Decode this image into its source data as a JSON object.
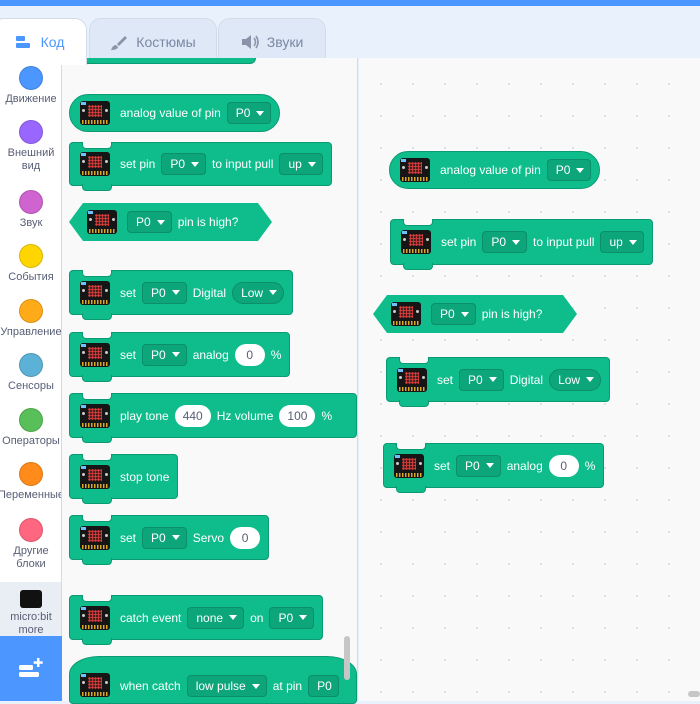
{
  "tabs": {
    "code": "Код",
    "costumes": "Костюмы",
    "sounds": "Звуки"
  },
  "categories": [
    {
      "label": "Движение",
      "color": "#4c97ff"
    },
    {
      "label": "Внешний вид",
      "color": "#9966ff"
    },
    {
      "label": "Звук",
      "color": "#cf63cf"
    },
    {
      "label": "События",
      "color": "#ffd500"
    },
    {
      "label": "Управление",
      "color": "#ffab19"
    },
    {
      "label": "Сенсоры",
      "color": "#5cb1d6"
    },
    {
      "label": "Операторы",
      "color": "#59c059"
    },
    {
      "label": "Переменные",
      "color": "#ff8c1a"
    },
    {
      "label": "Другие блоки",
      "color": "#ff6680"
    },
    {
      "label": "micro:bit more",
      "color": "#0fbd8c"
    }
  ],
  "blocks": {
    "analog_value": {
      "text": "analog value of pin",
      "pin": "P0"
    },
    "set_pull": {
      "set": "set pin",
      "pin": "P0",
      "mid": "to input pull",
      "pull": "up"
    },
    "pin_high": {
      "pin": "P0",
      "text": "pin is high?"
    },
    "set_digital": {
      "set": "set",
      "pin": "P0",
      "mid": "Digital",
      "value": "Low"
    },
    "set_analog": {
      "set": "set",
      "pin": "P0",
      "mid": "analog",
      "value": "0",
      "unit": "%"
    },
    "play_tone": {
      "text": "play tone",
      "freq": "440",
      "mid": "Hz volume",
      "volume": "100",
      "unit": "%"
    },
    "stop_tone": {
      "text": "stop tone"
    },
    "set_servo": {
      "set": "set",
      "pin": "P0",
      "mid": "Servo",
      "value": "0"
    },
    "catch_event": {
      "text": "catch event",
      "event": "none",
      "mid": "on",
      "pin": "P0"
    },
    "when_catch": {
      "text": "when catch",
      "event": "low pulse",
      "mid": "at pin",
      "pin": "P0"
    }
  },
  "colors": {
    "accent": "#4c97ff",
    "extension_green": "#0fbd8c"
  }
}
